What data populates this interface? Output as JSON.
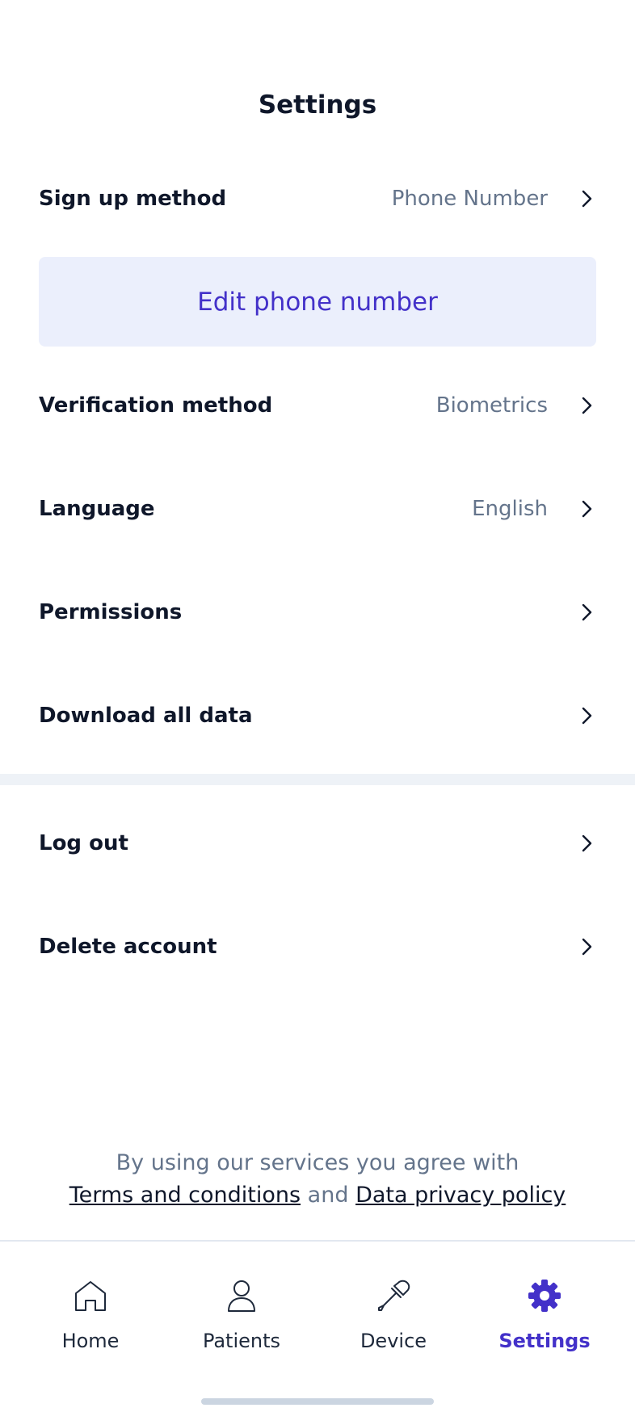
{
  "header": {
    "title": "Settings"
  },
  "rows": {
    "signup": {
      "label": "Sign up method",
      "value": "Phone Number"
    },
    "verification": {
      "label": "Verification method",
      "value": "Biometrics"
    },
    "language": {
      "label": "Language",
      "value": "English"
    },
    "permissions": {
      "label": "Permissions"
    },
    "download": {
      "label": "Download all data"
    },
    "logout": {
      "label": "Log out"
    },
    "delete": {
      "label": "Delete account"
    }
  },
  "edit_phone": {
    "label": "Edit phone number"
  },
  "legal": {
    "prefix": "By using our services you agree with",
    "terms": "Terms and conditions",
    "and": "and",
    "privacy": "Data privacy policy"
  },
  "tabs": [
    {
      "label": "Home",
      "icon": "home-icon"
    },
    {
      "label": "Patients",
      "icon": "user-icon"
    },
    {
      "label": "Device",
      "icon": "dropper-icon"
    },
    {
      "label": "Settings",
      "icon": "gear-icon",
      "active": true
    }
  ],
  "colors": {
    "accent": "#4331c9",
    "accent_bg": "#ebeffc",
    "text": "#0f172a",
    "muted": "#64748b"
  }
}
